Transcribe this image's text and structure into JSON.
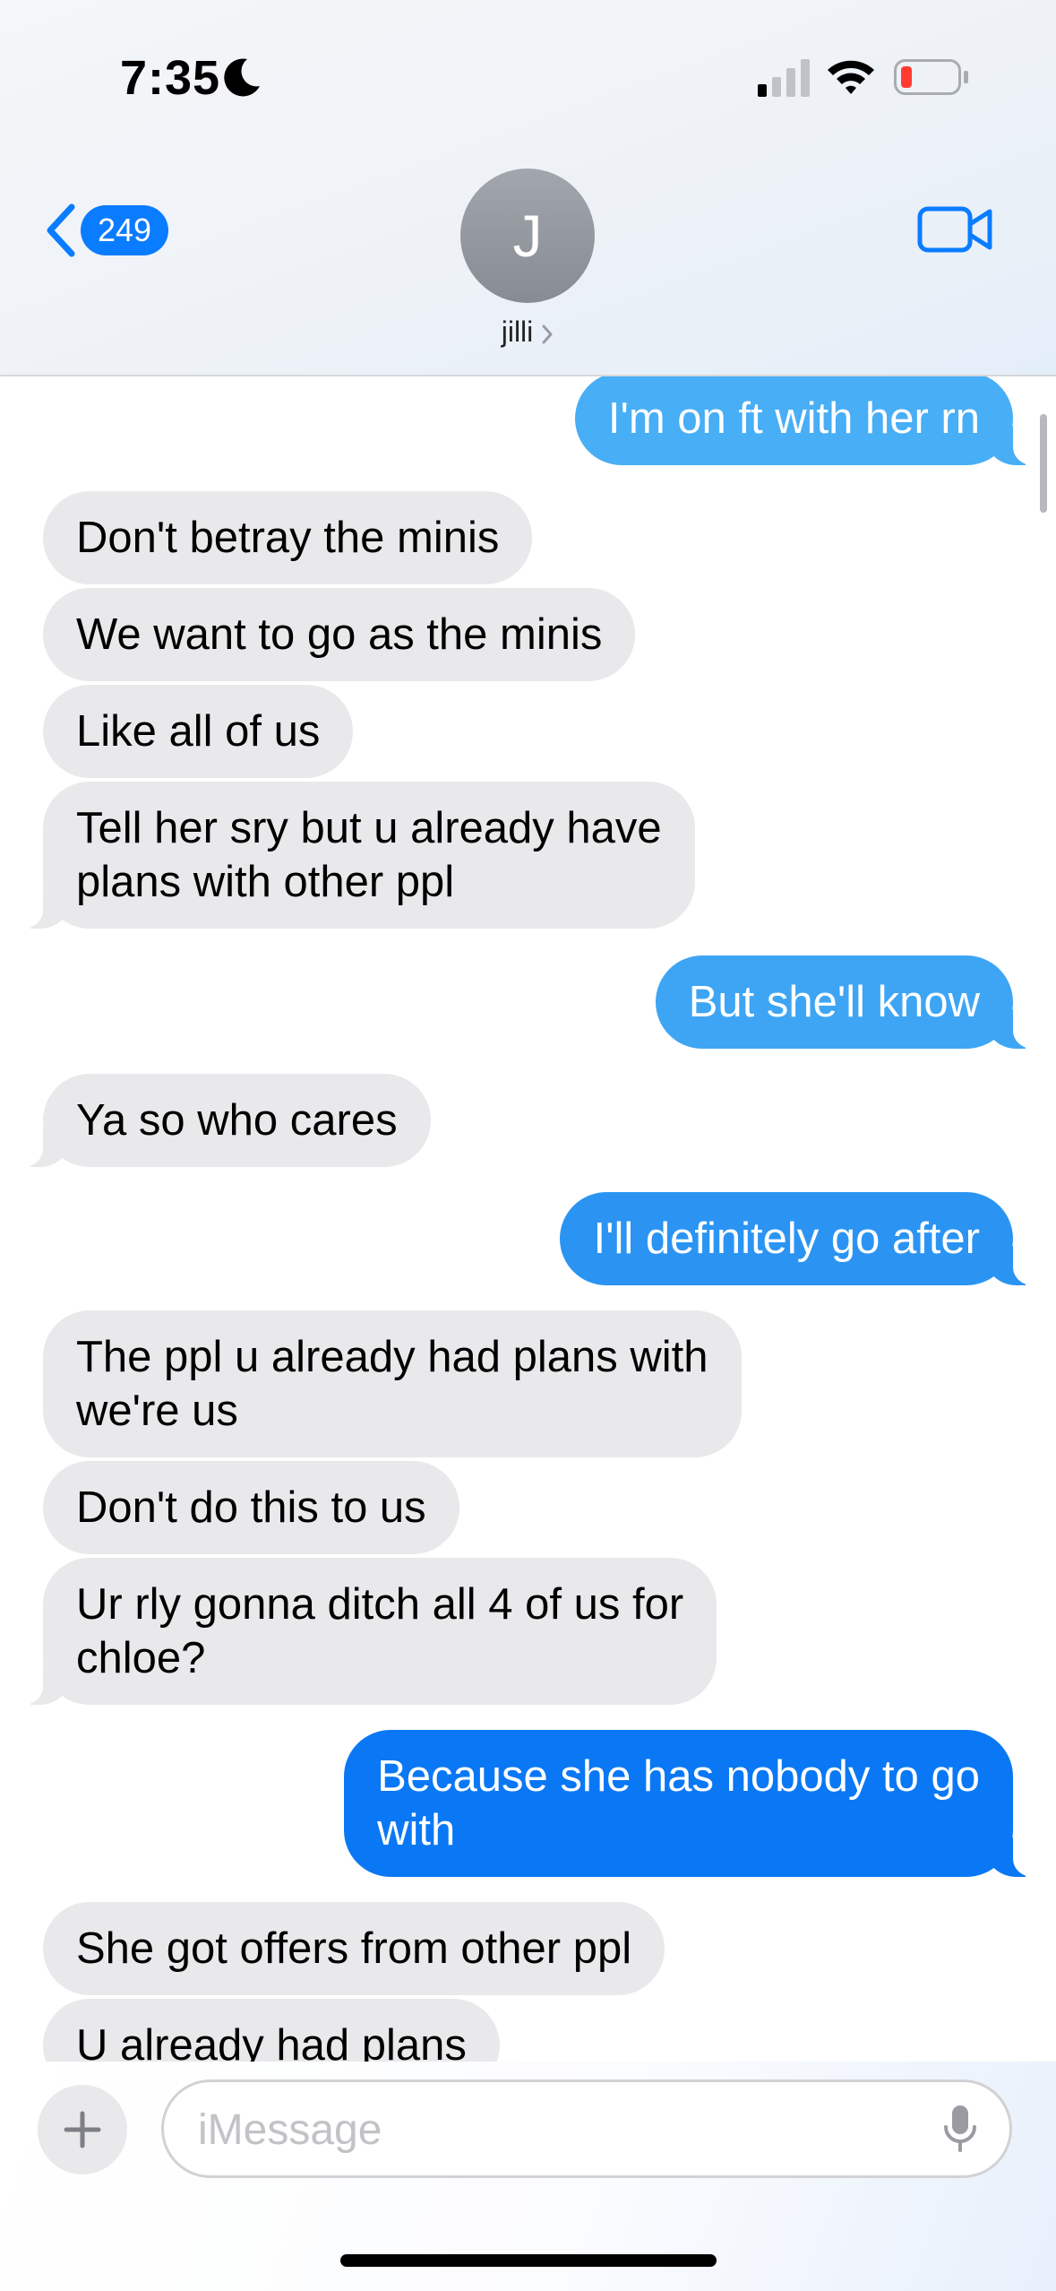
{
  "status_bar": {
    "time": "7:35",
    "focus_icon": "moon-icon",
    "battery_color": "#ff3b30"
  },
  "header": {
    "back_count": "249",
    "avatar_initial": "J",
    "contact_name": "jilli",
    "video_icon": "video-camera-icon",
    "accent_color": "#0a7cff"
  },
  "messages": [
    {
      "direction": "outgoing",
      "text": "I'm on ft with her rn"
    },
    {
      "direction": "incoming",
      "text": "Don't betray the minis"
    },
    {
      "direction": "incoming",
      "text": "We want to go as the minis"
    },
    {
      "direction": "incoming",
      "text": "Like all of us"
    },
    {
      "direction": "incoming",
      "text": "Tell her sry but u already have\nplans with other ppl"
    },
    {
      "direction": "outgoing",
      "text": "But she'll know"
    },
    {
      "direction": "incoming",
      "text": "Ya so who cares"
    },
    {
      "direction": "outgoing",
      "text": "I'll definitely go after"
    },
    {
      "direction": "incoming",
      "text": "The ppl u already had plans with\nwe're us"
    },
    {
      "direction": "incoming",
      "text": "Don't do this to us"
    },
    {
      "direction": "incoming",
      "text": "Ur rly gonna ditch all 4 of us for\nchloe?"
    },
    {
      "direction": "outgoing",
      "text": "Because she has nobody to go\nwith"
    },
    {
      "direction": "incoming",
      "text": "She got offers from other ppl"
    },
    {
      "direction": "incoming",
      "text": "U already had plans"
    }
  ],
  "input": {
    "placeholder": "iMessage",
    "plus_icon": "plus-icon",
    "mic_icon": "microphone-icon"
  }
}
